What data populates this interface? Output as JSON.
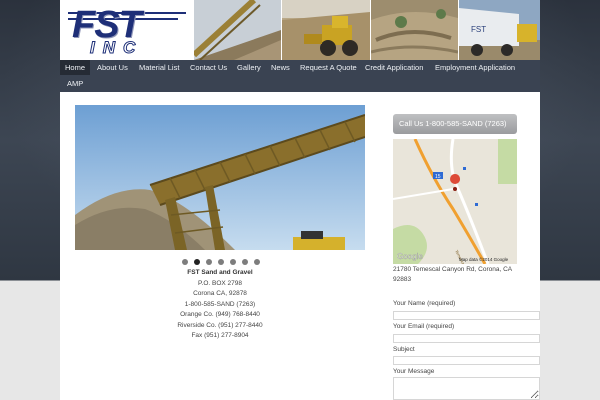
{
  "logo": {
    "main": "FST",
    "sub": "INC"
  },
  "header_photos": [
    "conveyor-photo",
    "loader-photo",
    "quarry-photo",
    "truck-photo"
  ],
  "nav": {
    "items": [
      {
        "label": "Home"
      },
      {
        "label": "About Us"
      },
      {
        "label": "Material List"
      },
      {
        "label": "Contact Us"
      },
      {
        "label": "Gallery"
      },
      {
        "label": "News"
      },
      {
        "label": "Request A Quote"
      },
      {
        "label": "Credit Application"
      },
      {
        "label": "Employment Application"
      },
      {
        "label": "AMP"
      }
    ],
    "active": "Home"
  },
  "slideshow": {
    "slide_count": 7,
    "active_index": 1
  },
  "contact": {
    "company": "FST Sand and Gravel",
    "lines": [
      "P.O. BOX 2798",
      "Corona CA, 92878",
      "1-800-585-SAND (7263)",
      "Orange Co. (949) 768-8440",
      "Riverside Co. (951) 277-8440",
      "Fax (951) 277-8904"
    ]
  },
  "sidebar": {
    "call_button": "Call Us 1-800-585-SAND (7263)",
    "map": {
      "road_label": "15",
      "road_name": "Temescal Canyon Rd",
      "data_text": "Map data ©2014 Google",
      "brand": "Google"
    },
    "map_address": "21780 Temescal Canyon Rd, Corona, CA 92883"
  },
  "form": {
    "name_label": "Your Name (required)",
    "email_label": "Your Email (required)",
    "subject_label": "Subject",
    "message_label": "Your Message",
    "name_value": "",
    "email_value": "",
    "subject_value": ""
  },
  "colors": {
    "nav_bg": "#3a4352",
    "nav_active": "#252b35",
    "logo_blue": "#1e2f78",
    "accent_road": "#f0a030"
  }
}
